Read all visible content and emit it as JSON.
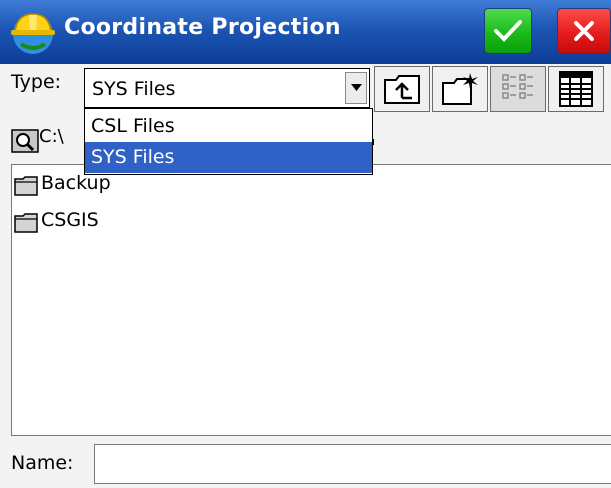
{
  "window": {
    "title": "Coordinate Projection",
    "icon": "hard-hat-globe-icon",
    "ok_icon": "checkmark-icon",
    "close_icon": "close-x-icon"
  },
  "type_row": {
    "label": "Type:",
    "selected_value": "SYS Files",
    "options": [
      "CSL Files",
      "SYS Files"
    ],
    "highlighted_option": "SYS Files"
  },
  "toolbar": [
    {
      "name": "up-folder-button",
      "icon": "folder-up-icon"
    },
    {
      "name": "new-folder-button",
      "icon": "new-folder-icon"
    },
    {
      "name": "list-view-button",
      "icon": "list-view-icon"
    },
    {
      "name": "detail-view-button",
      "icon": "detail-view-icon"
    }
  ],
  "path": {
    "icon": "folder-search-icon",
    "text": "C:\\"
  },
  "files": [
    {
      "name": "Backup",
      "icon": "folder-icon"
    },
    {
      "name": "CSGIS",
      "icon": "folder-icon"
    }
  ],
  "name_row": {
    "label": "Name:",
    "value": ""
  },
  "colors": {
    "titlebar": "#1d55b4",
    "ok_button": "#17b817",
    "close_button": "#e21a1a",
    "selection": "#3061c6"
  }
}
